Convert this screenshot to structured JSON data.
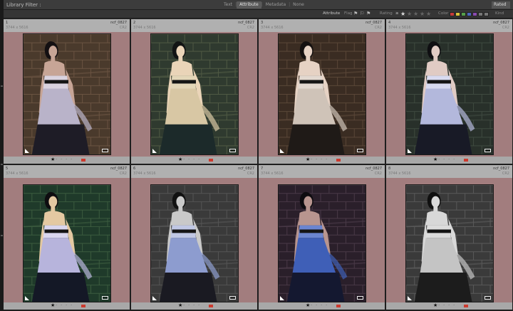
{
  "filter_bar": {
    "title": "Library Filter :",
    "tabs": [
      {
        "label": "Text",
        "active": false
      },
      {
        "label": "Attribute",
        "active": true
      },
      {
        "label": "Metadata",
        "active": false
      },
      {
        "label": "None",
        "active": false
      }
    ],
    "preset": "Rated"
  },
  "attribute_bar": {
    "attribute_label": "Attribute",
    "flag_label": "Flag",
    "rating_label": "Rating",
    "rating_operator": "≥",
    "rating_value": 1,
    "color_label": "Color",
    "kind_label": "Kind",
    "colors": [
      "#c63a3a",
      "#d8c23a",
      "#55a04a",
      "#4a67c0",
      "#8a4ab0",
      "#777777",
      "#777777"
    ]
  },
  "thumbnails": [
    {
      "index": "1",
      "name": "ncf_0827",
      "dims": "3744 x 5616",
      "ext": "CR2",
      "rating": 1,
      "tone": "natural"
    },
    {
      "index": "2",
      "name": "ncf_0827",
      "dims": "3744 x 5616",
      "ext": "CR2",
      "rating": 1,
      "tone": "warm"
    },
    {
      "index": "3",
      "name": "ncf_0827",
      "dims": "3744 x 5616",
      "ext": "CR2",
      "rating": 1,
      "tone": "sepia"
    },
    {
      "index": "4",
      "name": "ncf_0827",
      "dims": "3744 x 5616",
      "ext": "CR2",
      "rating": 1,
      "tone": "cool"
    },
    {
      "index": "5",
      "name": "ncf_0827",
      "dims": "3744 x 5616",
      "ext": "CR2",
      "rating": 1,
      "tone": "vivid"
    },
    {
      "index": "6",
      "name": "ncf_0827",
      "dims": "3744 x 5616",
      "ext": "CR2",
      "rating": 1,
      "tone": "desaturated"
    },
    {
      "index": "7",
      "name": "ncf_0827",
      "dims": "3744 x 5616",
      "ext": "CR2",
      "rating": 1,
      "tone": "blue"
    },
    {
      "index": "8",
      "name": "ncf_0827",
      "dims": "3744 x 5616",
      "ext": "CR2",
      "rating": 1,
      "tone": "bw"
    }
  ]
}
